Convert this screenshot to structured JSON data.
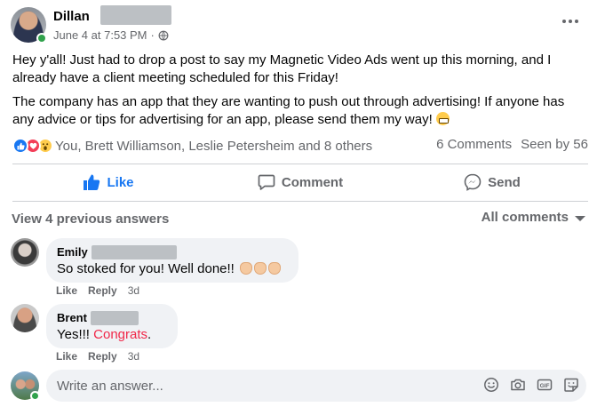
{
  "post": {
    "author": "Dillan",
    "date": "June 4 at 7:53 PM",
    "separator": "·",
    "paragraph1": "Hey y'all! Just had to drop a post to say my Magnetic Video Ads went up this morning, and I already have a client meeting scheduled for this Friday!",
    "paragraph2": "The company has an app that they are wanting to push out through advertising! If anyone has any advice or tips for advertising for an app, please send them my way!",
    "emoji": "grinning-face-with-teeth"
  },
  "reactions": {
    "types": [
      "like",
      "love",
      "wow"
    ],
    "summary": "You, Brett Williamson, Leslie Petersheim and 8 others",
    "comments_count": "6 Comments",
    "seen_by": "Seen by 56"
  },
  "actions": {
    "like": "Like",
    "comment": "Comment",
    "send": "Send"
  },
  "comments_section": {
    "view_previous": "View 4 previous answers",
    "sort_label": "All comments"
  },
  "comments": [
    {
      "name": "Emily",
      "text": "So stoked for you! Well done!!",
      "emoji": "clapping-hands x3",
      "like": "Like",
      "reply": "Reply",
      "time": "3d"
    },
    {
      "name": "Brent",
      "text_prefix": "Yes!!! ",
      "tag": "Congrats",
      "text_suffix": ".",
      "like": "Like",
      "reply": "Reply",
      "time": "3d"
    }
  ],
  "composer": {
    "placeholder": "Write an answer..."
  },
  "colors": {
    "accent": "#1877f2",
    "text_secondary": "#65676b",
    "bubble": "#f0f2f5",
    "online": "#31a24c",
    "tag": "#f02849"
  }
}
